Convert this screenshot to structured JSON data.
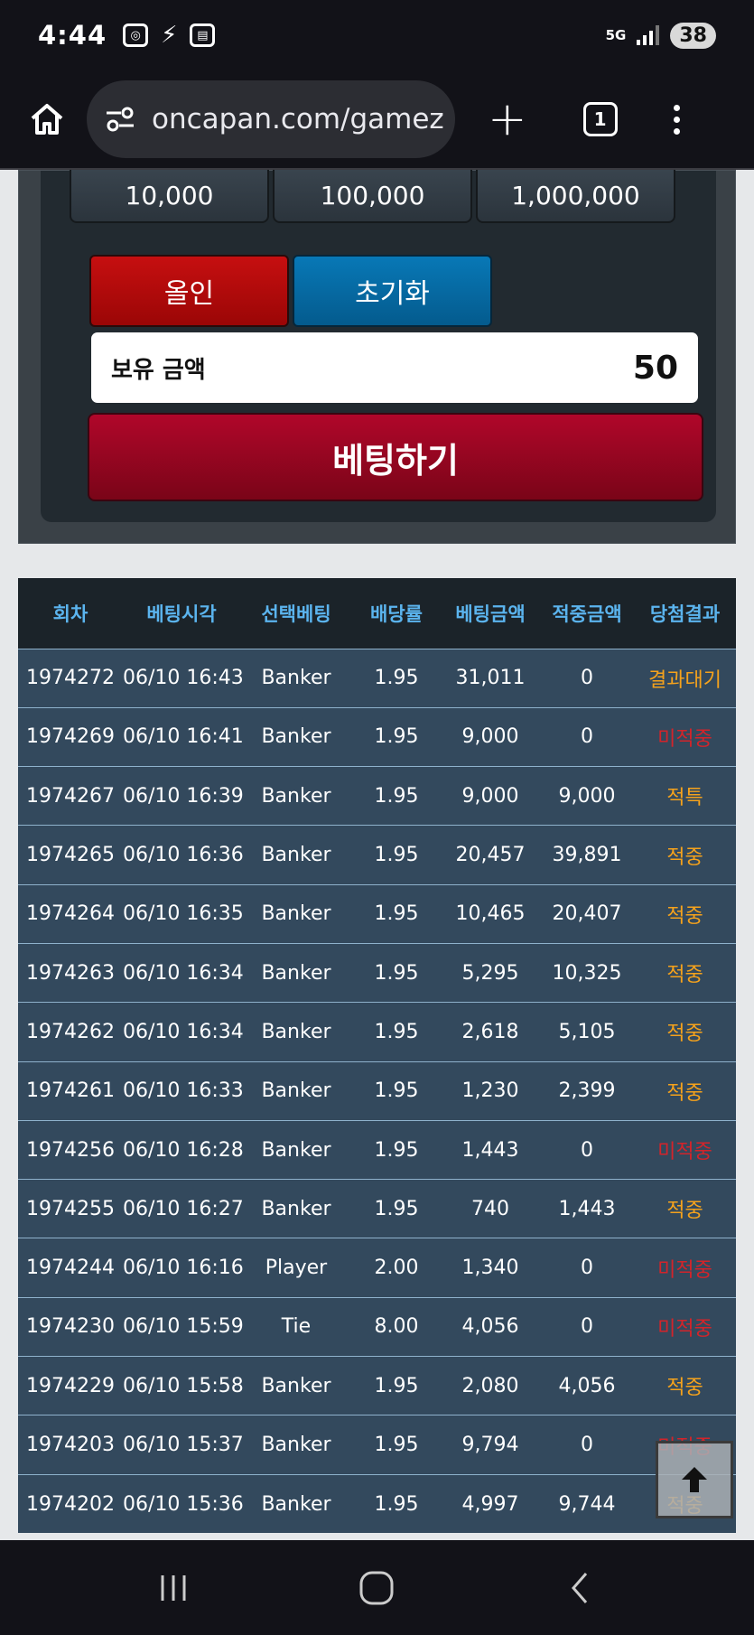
{
  "status_bar": {
    "time": "4:44",
    "network": "5G",
    "battery": "38"
  },
  "browser": {
    "url": "oncapan.com/gamez",
    "tab_count": "1"
  },
  "bet_panel": {
    "chips": [
      "10,000",
      "100,000",
      "1,000,000"
    ],
    "all_in_label": "올인",
    "reset_label": "초기화",
    "balance_label": "보유 금액",
    "balance_value": "50",
    "submit_label": "베팅하기"
  },
  "history": {
    "headers": [
      "회차",
      "베팅시각",
      "선택베팅",
      "배당률",
      "베팅금액",
      "적중금액",
      "당첨결과"
    ],
    "rows": [
      [
        "1974272",
        "06/10 16:43",
        "Banker",
        "1.95",
        "31,011",
        "0",
        "결과대기"
      ],
      [
        "1974269",
        "06/10 16:41",
        "Banker",
        "1.95",
        "9,000",
        "0",
        "미적중"
      ],
      [
        "1974267",
        "06/10 16:39",
        "Banker",
        "1.95",
        "9,000",
        "9,000",
        "적특"
      ],
      [
        "1974265",
        "06/10 16:36",
        "Banker",
        "1.95",
        "20,457",
        "39,891",
        "적중"
      ],
      [
        "1974264",
        "06/10 16:35",
        "Banker",
        "1.95",
        "10,465",
        "20,407",
        "적중"
      ],
      [
        "1974263",
        "06/10 16:34",
        "Banker",
        "1.95",
        "5,295",
        "10,325",
        "적중"
      ],
      [
        "1974262",
        "06/10 16:34",
        "Banker",
        "1.95",
        "2,618",
        "5,105",
        "적중"
      ],
      [
        "1974261",
        "06/10 16:33",
        "Banker",
        "1.95",
        "1,230",
        "2,399",
        "적중"
      ],
      [
        "1974256",
        "06/10 16:28",
        "Banker",
        "1.95",
        "1,443",
        "0",
        "미적중"
      ],
      [
        "1974255",
        "06/10 16:27",
        "Banker",
        "1.95",
        "740",
        "1,443",
        "적중"
      ],
      [
        "1974244",
        "06/10 16:16",
        "Player",
        "2.00",
        "1,340",
        "0",
        "미적중"
      ],
      [
        "1974230",
        "06/10 15:59",
        "Tie",
        "8.00",
        "4,056",
        "0",
        "미적중"
      ],
      [
        "1974229",
        "06/10 15:58",
        "Banker",
        "1.95",
        "2,080",
        "4,056",
        "적중"
      ],
      [
        "1974203",
        "06/10 15:37",
        "Banker",
        "1.95",
        "9,794",
        "0",
        "미적중"
      ],
      [
        "1974202",
        "06/10 15:36",
        "Banker",
        "1.95",
        "4,997",
        "9,744",
        "적중"
      ]
    ]
  },
  "colors": {
    "win": "#f5a21c",
    "lose": "#d3242a",
    "header_text": "#5bb4ee",
    "row_bg": "#33495d"
  }
}
